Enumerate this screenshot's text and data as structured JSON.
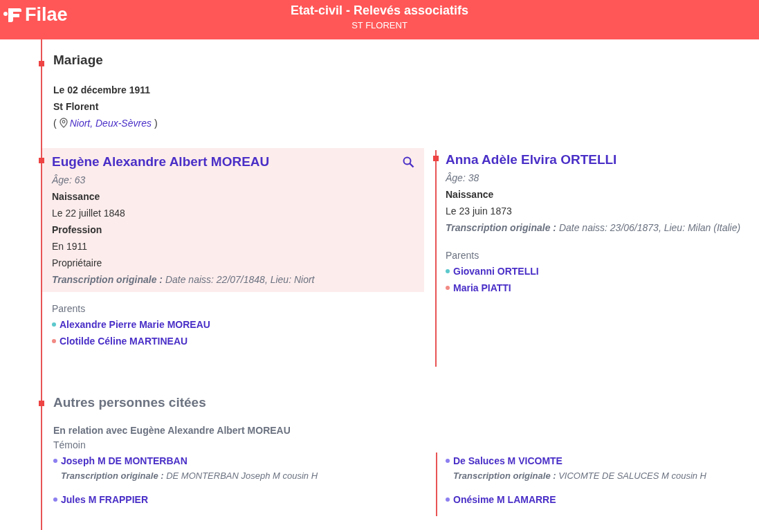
{
  "header": {
    "logo_text": "Filae",
    "title": "Etat-civil - Relevés associatifs",
    "subtitle": "ST FLORENT"
  },
  "mariage": {
    "heading": "Mariage",
    "date": "Le 02 décembre 1911",
    "place": "St Florent",
    "paren_open": "(",
    "location": "Niort, Deux-Sèvres",
    "paren_close": ")"
  },
  "persons": [
    {
      "name": "Eugène Alexandre Albert MOREAU",
      "highlighted": true,
      "search": true,
      "age": "Âge: 63",
      "events": [
        {
          "label": "Naissance",
          "lines": [
            "Le 22 juillet 1848"
          ]
        },
        {
          "label": "Profession",
          "lines": [
            "En 1911",
            "Propriétaire"
          ]
        }
      ],
      "transcription_label": "Transcription originale :",
      "transcription": "Date naiss: 22/07/1848, Lieu: Niort",
      "parents_label": "Parents",
      "parents": [
        {
          "name": "Alexandre Pierre Marie MOREAU",
          "color": "#5cc8cc"
        },
        {
          "name": "Clotilde Céline MARTINEAU",
          "color": "#f28a84"
        }
      ]
    },
    {
      "name": "Anna Adèle Elvira ORTELLI",
      "highlighted": false,
      "search": false,
      "age": "Âge: 38",
      "events": [
        {
          "label": "Naissance",
          "lines": [
            "Le 23 juin 1873"
          ]
        }
      ],
      "transcription_label": "Transcription originale :",
      "transcription": "Date naiss: 23/06/1873, Lieu: Milan (Italie)",
      "parents_label": "Parents",
      "parents": [
        {
          "name": "Giovanni ORTELLI",
          "color": "#5cc8cc"
        },
        {
          "name": "Maria PIATTI",
          "color": "#f28a84"
        }
      ]
    }
  ],
  "others": {
    "heading": "Autres personnes citées",
    "relation": "En relation avec Eugène Alexandre Albert MOREAU",
    "role": "Témoin",
    "witnesses": [
      {
        "name": "Joseph M DE MONTERBAN",
        "transcription_label": "Transcription originale :",
        "transcription": "DE MONTERBAN Joseph M cousin H"
      },
      {
        "name": "De Saluces M VICOMTE",
        "transcription_label": "Transcription originale :",
        "transcription": "VICOMTE DE SALUCES M cousin H"
      },
      {
        "name": "Jules M FRAPPIER"
      },
      {
        "name": "Onésime M LAMARRE"
      }
    ]
  }
}
